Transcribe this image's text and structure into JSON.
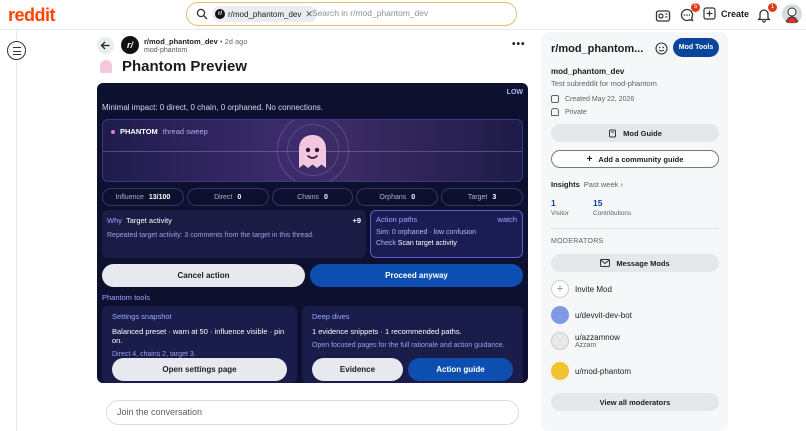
{
  "topbar": {
    "logo": "reddit",
    "search_chip": "r/mod_phantom_dev",
    "search_placeholder": "Search in r/mod_phantom_dev",
    "chat_badge": "5",
    "notif_badge": "1",
    "create_label": "Create"
  },
  "post": {
    "subreddit": "r/mod_phantom_dev",
    "time": "• 2d ago",
    "user": "mod-phantom",
    "title": "Phantom Preview",
    "more": "•••"
  },
  "panel": {
    "level": "LOW",
    "impact": "Minimal impact: 0 direct, 0 chain, 0 orphaned. No connections.",
    "hero_name": "PHANTOM",
    "hero_mode": "thread sweep",
    "stats": [
      {
        "label": "Influence",
        "value": "13/100"
      },
      {
        "label": "Direct",
        "value": "0"
      },
      {
        "label": "Chains",
        "value": "0"
      },
      {
        "label": "Orphans",
        "value": "0"
      },
      {
        "label": "Target",
        "value": "3"
      }
    ],
    "why": {
      "key": "Why",
      "value": "Target activity",
      "score": "+9",
      "detail": "Repeated target activity: 3 comments from the target in this thread."
    },
    "paths": {
      "title": "Action paths",
      "status": "watch",
      "sim_key": "Sim:",
      "sim_value": "0 orphaned · low confusion",
      "check_key": "Check",
      "check_value": "Scan target activity"
    },
    "cancel_label": "Cancel action",
    "proceed_label": "Proceed anyway",
    "tools_label": "Phantom tools",
    "settings": {
      "title": "Settings snapshot",
      "line1": "Balanced preset · warn at 50 · influence visible · pin on.",
      "line2": "Direct 4, chains 2, target 3.",
      "button": "Open settings page"
    },
    "dives": {
      "title": "Deep dives",
      "line1": "1 evidence snippets · 1 recommended paths.",
      "line2": "Open focused pages for the full rationale and action guidance.",
      "evidence_button": "Evidence",
      "guide_button": "Action guide"
    }
  },
  "comment_placeholder": "Join the conversation",
  "sidebar": {
    "title": "r/mod_phantom...",
    "mod_tools": "Mod Tools",
    "name": "mod_phantom_dev",
    "description": "Test subreddit for mod-phantom",
    "created": "Created May 22, 2026",
    "privacy": "Private",
    "mod_guide": "Mod Guide",
    "add_guide": "Add a community guide",
    "insights_label": "Insights",
    "insights_period": "Past week ›",
    "visitors_num": "1",
    "visitors_label": "Visitor",
    "contrib_num": "15",
    "contrib_label": "Contributions",
    "moderators_heading": "MODERATORS",
    "message_mods": "Message Mods",
    "invite_mod": "Invite Mod",
    "mods": [
      {
        "name": "u/devvit-dev-bot",
        "sub": ""
      },
      {
        "name": "u/azzamnow",
        "sub": "Azzam"
      },
      {
        "name": "u/mod-phantom",
        "sub": ""
      }
    ],
    "view_all": "View all moderators"
  }
}
